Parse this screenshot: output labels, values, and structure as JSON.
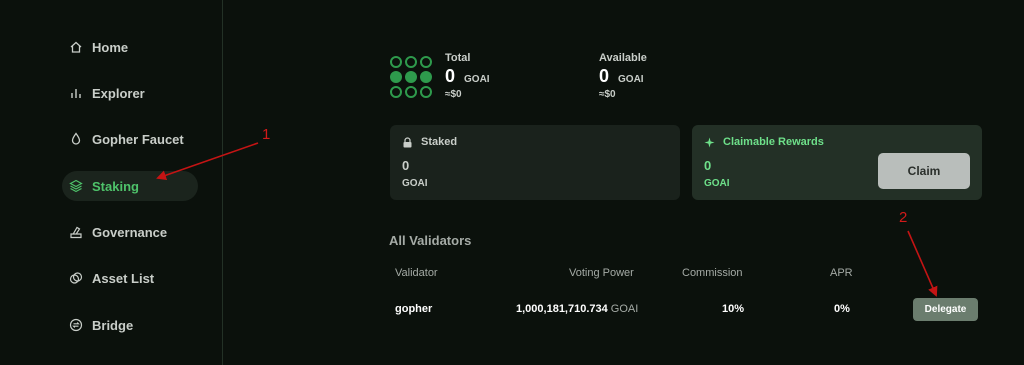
{
  "sidebar": {
    "items": [
      {
        "label": "Home",
        "icon": "home-icon"
      },
      {
        "label": "Explorer",
        "icon": "bar-chart-icon"
      },
      {
        "label": "Gopher Faucet",
        "icon": "droplet-icon"
      },
      {
        "label": "Staking",
        "icon": "layers-icon",
        "active": true
      },
      {
        "label": "Governance",
        "icon": "ballot-icon"
      },
      {
        "label": "Asset List",
        "icon": "coins-icon"
      },
      {
        "label": "Bridge",
        "icon": "exchange-icon"
      }
    ]
  },
  "balances": {
    "total": {
      "label": "Total",
      "value": "0",
      "unit": "GOAI",
      "usd": "≈$0"
    },
    "available": {
      "label": "Available",
      "value": "0",
      "unit": "GOAI",
      "usd": "≈$0"
    }
  },
  "cards": {
    "staked": {
      "label": "Staked",
      "value": "0",
      "unit": "GOAI",
      "icon": "lock-icon"
    },
    "rewards": {
      "label": "Claimable Rewards",
      "value": "0",
      "unit": "GOAI",
      "icon": "sparkle-icon",
      "button": "Claim"
    }
  },
  "validators": {
    "title": "All Validators",
    "columns": [
      "Validator",
      "Voting Power",
      "Commission",
      "APR"
    ],
    "rows": [
      {
        "name": "gopher",
        "voting_power": "1,000,181,710.734",
        "vp_unit": "GOAI",
        "commission": "10%",
        "apr": "0%",
        "button": "Delegate"
      }
    ]
  },
  "annotations": {
    "one": "1",
    "two": "2"
  },
  "colors": {
    "accent": "#4ec26a",
    "annotation": "#d11a1a",
    "background": "#0b110c"
  }
}
